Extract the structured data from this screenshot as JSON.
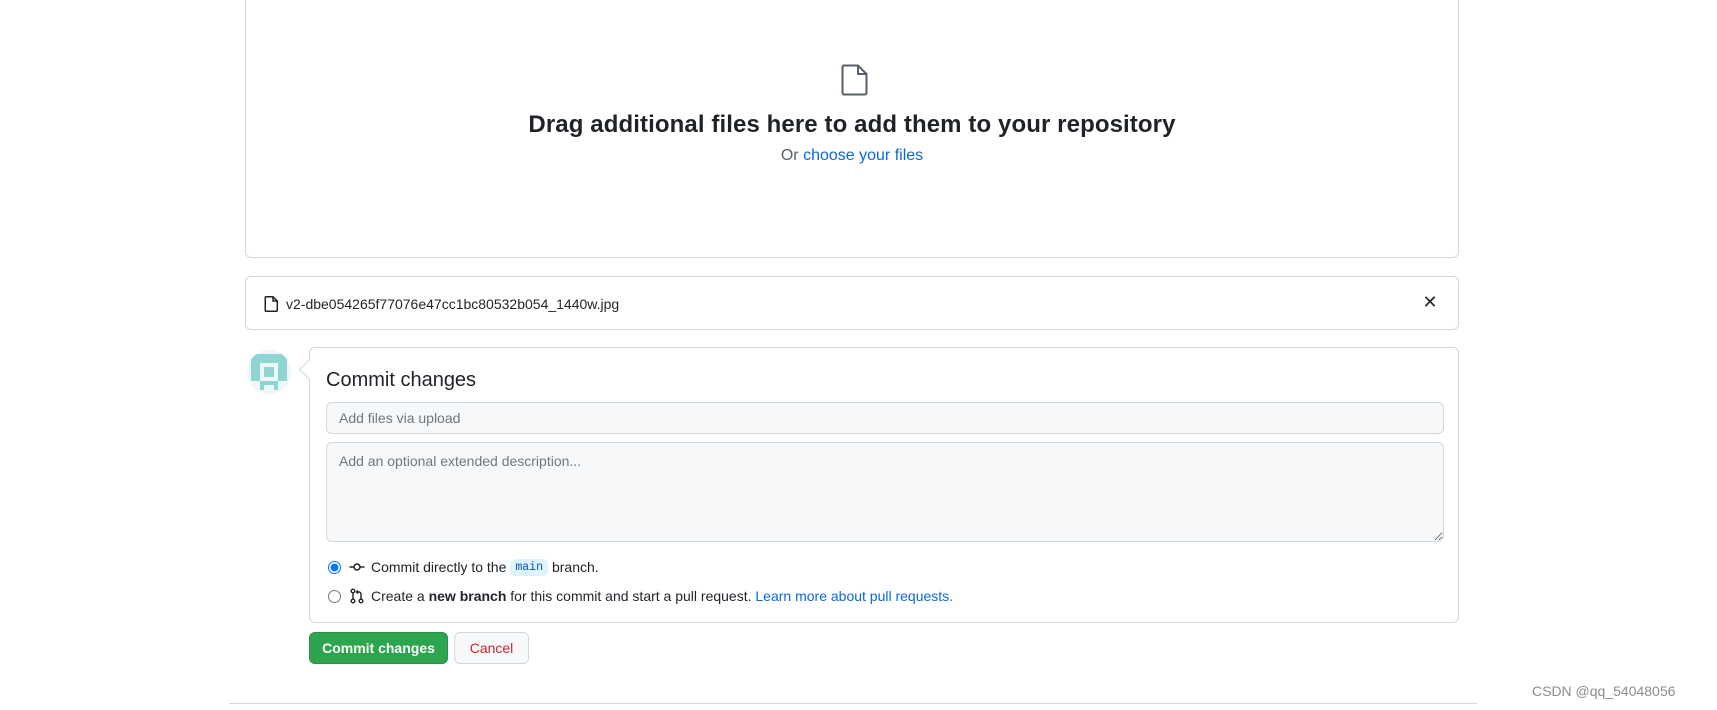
{
  "dropzone": {
    "icon": "file-icon",
    "title": "Drag additional files here to add them to your repository",
    "subtitle_prefix": "Or",
    "choose_link": "choose your files"
  },
  "uploaded_file": {
    "icon": "file-icon",
    "name": "v2-dbe054265f77076e47cc1bc80532b054_1440w.jpg",
    "remove_glyph": "✕"
  },
  "commit": {
    "title": "Commit changes",
    "summary_placeholder": "Add files via upload",
    "summary_value": "",
    "description_placeholder": "Add an optional extended description...",
    "description_value": "",
    "option_direct": {
      "selected": true,
      "icon": "git-commit-icon",
      "prefix": "Commit directly to the",
      "branch": "main",
      "suffix": "branch."
    },
    "option_new_branch": {
      "selected": false,
      "icon": "git-pull-request-icon",
      "prefix": "Create a",
      "bold": "new branch",
      "middle": "for this commit and start a pull request.",
      "link": "Learn more about pull requests."
    }
  },
  "buttons": {
    "commit_label": "Commit changes",
    "cancel_label": "Cancel"
  },
  "colors": {
    "primary_green": "#2da44e",
    "link_blue": "#0969da",
    "cancel_red": "#cf222e",
    "border": "#d0d7de"
  },
  "watermark": "CSDN @qq_54048056"
}
